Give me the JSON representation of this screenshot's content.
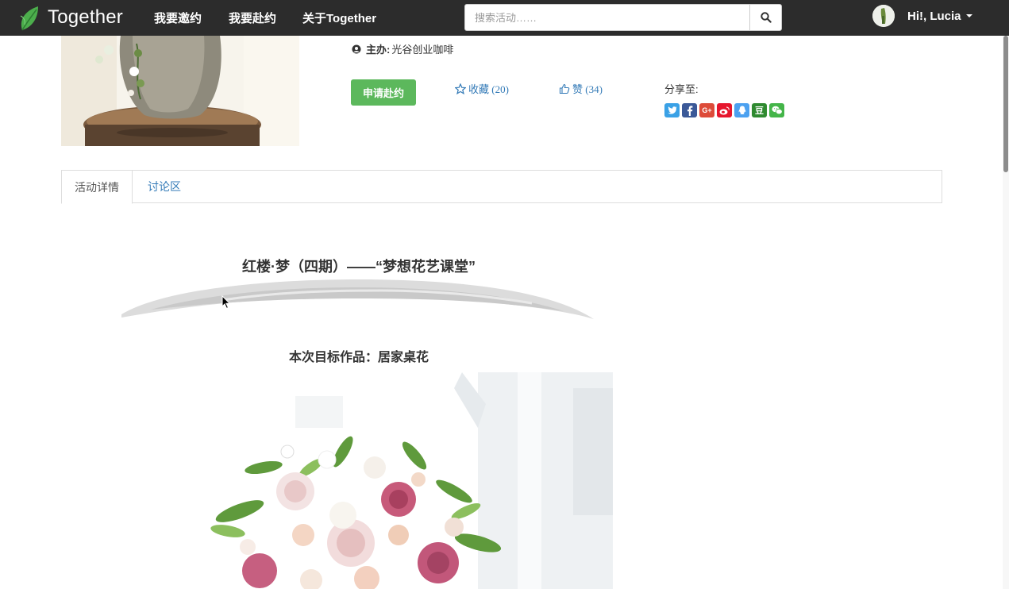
{
  "navbar": {
    "brand": "Together",
    "links": [
      "我要邀约",
      "我要赴约",
      "关于Together"
    ],
    "search_placeholder": "搜索活动……",
    "user_greeting": "Hi!, Lucia"
  },
  "event": {
    "host_label": "主办:",
    "host_name": "光谷创业咖啡",
    "apply_label": "申请赴约",
    "favorite_label": "收藏 (20)",
    "like_label": "赞 (34)",
    "share_label": "分享至:",
    "share_targets": [
      "twitter",
      "facebook",
      "google-plus",
      "weibo",
      "qq",
      "douban",
      "wechat"
    ],
    "share_colors": [
      "#3aa1e6",
      "#3b5998",
      "#dd4b39",
      "#e6162d",
      "#4ca1f0",
      "#2f8a30",
      "#44b549"
    ]
  },
  "tabs": [
    "活动详情",
    "讨论区"
  ],
  "content": {
    "title": "红楼·梦（四期）——“梦想花艺课堂”",
    "subtitle": "本次目标作品：居家桌花"
  },
  "colors": {
    "navbar_bg": "#2c2c2c",
    "accent_green": "#5cb85c",
    "link_blue": "#337ab7"
  }
}
